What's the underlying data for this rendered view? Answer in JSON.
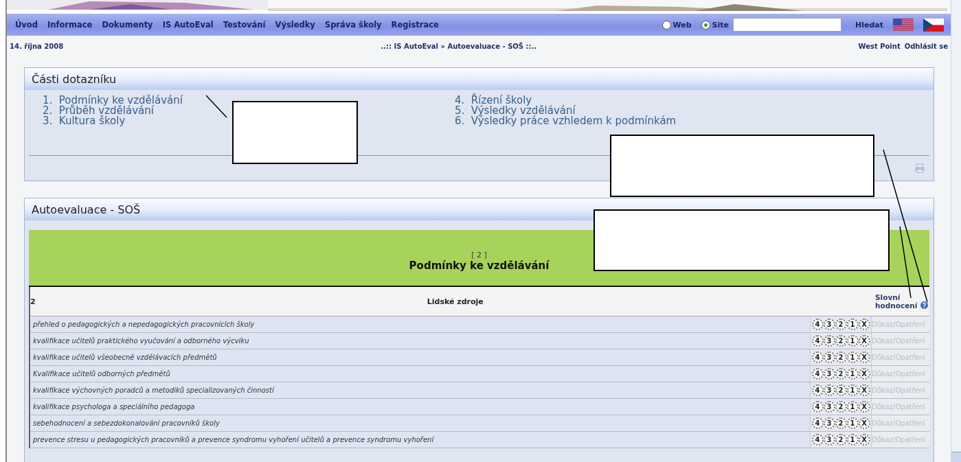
{
  "nav": {
    "items": [
      "Úvod",
      "Informace",
      "Dokumenty",
      "IS AutoEval",
      "Testování",
      "Výsledky",
      "Správa školy",
      "Registrace"
    ],
    "search_scope": [
      {
        "label": "Web",
        "selected": false
      },
      {
        "label": "Site",
        "selected": true
      }
    ],
    "search_button": "Hledat"
  },
  "info_bar": {
    "date": "14. října 2008",
    "breadcrumb": "..:: IS AutoEval » Autoevaluace - SOŠ ::..",
    "user": "West Point",
    "logout": "Odhlásit se"
  },
  "parts_panel": {
    "title": "Části dotazníku",
    "items": [
      {
        "number": "1.",
        "label": "Podmínky ke vzdělávání"
      },
      {
        "number": "2.",
        "label": "Průběh vzdělávání"
      },
      {
        "number": "3.",
        "label": "Kultura školy"
      },
      {
        "number": "4.",
        "label": "Řízení školy"
      },
      {
        "number": "5.",
        "label": "Výsledky vzdělávání"
      },
      {
        "number": "6.",
        "label": "Výsledky práce vzhledem k podmínkám"
      }
    ]
  },
  "eval_panel": {
    "title": "Autoevaluace - SOŠ",
    "section_number": "[ 2 ]",
    "section_title": "Podmínky ke vzdělávání",
    "table": {
      "columns": [
        "2",
        "Lidské zdroje",
        "Slovní hodnocení"
      ],
      "rows": [
        {
          "text": "přehled o pedagogických a nepedagogických pracovnících školy",
          "ratings": [
            "4",
            "3",
            "2",
            "1",
            "X"
          ],
          "evidence_link": "Důkaz/Opatření"
        },
        {
          "text": "kvalifikace učitelů praktického vyučování a odborného výcviku",
          "ratings": [
            "4",
            "3",
            "2",
            "1",
            "X"
          ],
          "evidence_link": "Důkaz/Opatření"
        },
        {
          "text": "kvalifikace učitelů všeobecně vzdělávacích předmětů",
          "ratings": [
            "4",
            "3",
            "2",
            "1",
            "X"
          ],
          "evidence_link": "Důkaz/Opatření"
        },
        {
          "text": "Kvalifikace učitelů odborných předmětů",
          "ratings": [
            "4",
            "3",
            "2",
            "1",
            "X"
          ],
          "evidence_link": "Důkaz/Opatření"
        },
        {
          "text": "kvalifikace výchovných poradců a metodiků specializovaných činností",
          "ratings": [
            "4",
            "3",
            "2",
            "1",
            "X"
          ],
          "evidence_link": "Důkaz/Opatření"
        },
        {
          "text": "kvalifikace psychologa a speciálního pedagoga",
          "ratings": [
            "4",
            "3",
            "2",
            "1",
            "X"
          ],
          "evidence_link": "Důkaz/Opatření"
        },
        {
          "text": "sebehodnocení a sebezdokonalování pracovníků školy",
          "ratings": [
            "4",
            "3",
            "2",
            "1",
            "X"
          ],
          "evidence_link": "Důkaz/Opatření"
        },
        {
          "text": "prevence stresu u pedagogických pracovníků a prevence syndromu vyhoření učitelů a prevence syndromu vyhoření",
          "ratings": [
            "4",
            "3",
            "2",
            "1",
            "X"
          ],
          "evidence_link": "Důkaz/Opatření"
        }
      ]
    }
  },
  "callouts": [
    {
      "kind": "callout"
    },
    {
      "kind": "callout"
    },
    {
      "kind": "callout"
    }
  ]
}
